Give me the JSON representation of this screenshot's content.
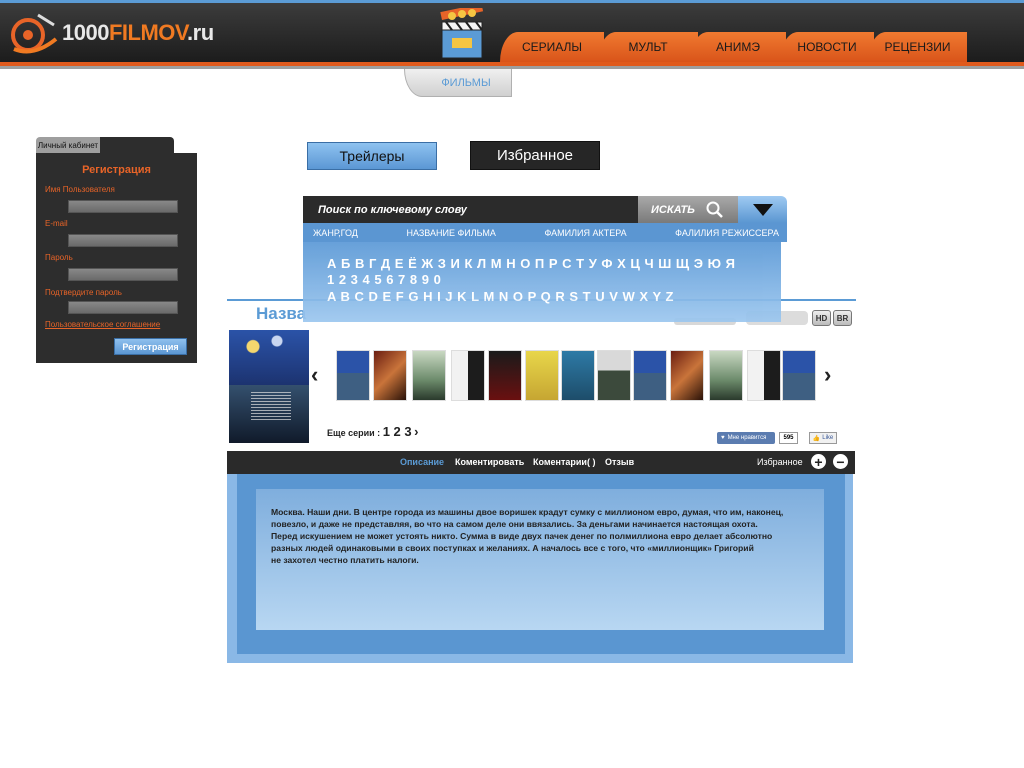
{
  "logo": {
    "text_a": "1000",
    "text_b": "FILMOV",
    "text_c": ".ru",
    "icon": "film-reel-logo-icon"
  },
  "nav": {
    "items": [
      "СЕРИАЛЫ",
      "МУЛЬТ",
      "АНИМЭ",
      "НОВОСТИ",
      "РЕЦЕНЗИИ"
    ],
    "sub_tab": "ФИЛЬМЫ",
    "clapper_icon": "clapperboard-icon"
  },
  "cabinet": {
    "tab_label": "Личный кабинет",
    "title": "Регистрация",
    "fields": [
      "Имя Пользователя",
      "E-mail",
      "Пароль",
      "Подтвердите пароль"
    ],
    "agreement": "Пользовательское соглашение",
    "submit": "Регистрация"
  },
  "buttons": {
    "trailers": "Трейлеры",
    "favorites": "Избранное"
  },
  "search": {
    "placeholder": "Поиск по ключевому слову",
    "button": "ИСКАТЬ",
    "search_icon": "magnifier-icon",
    "dropdown_icon": "triangle-down-icon"
  },
  "filters": [
    "ЖАНР,ГОД",
    "НАЗВАНИЕ ФИЛЬМА",
    "ФАМИЛИЯ АКТЕРА",
    "ФАЛИЛИЯ РЕЖИССЕРА"
  ],
  "alphabet": {
    "cyrillic": "А Б В Г Д Е Ё Ж З И К Л М Н О П Р С Т У Ф Х Ц Ч Ш Щ Э Ю Я",
    "digits": "1 2 3 4 5 6 7 8 9 0",
    "latin": "A B C D E F G H I J K L M N O P Q R S T U V W X Y Z"
  },
  "film": {
    "title_visible": "Назва",
    "quality": [
      "HD",
      "BR"
    ],
    "more_series_label": "Еще серии :",
    "more_series_pages": "1 2 3",
    "more_arrow": "›"
  },
  "social": {
    "like_label": "Мне нравится",
    "like_count": "595",
    "fb_label": "Like"
  },
  "info_bar": {
    "tabs": [
      "Описание",
      "Коментировать",
      "Коментарии( )",
      "Отзыв"
    ],
    "favorites": "Избранное"
  },
  "description": "Москва. Наши дни. В центре города из машины двое воришек крадут сумку с миллионом евро, думая, что им, наконец,\n повезло, и даже не представляя, во что на самом деле они ввязались. За деньгами начинается настоящая охота.\nПеред искушением не может устоять никто. Сумма в виде двух пачек денег по полмиллиона евро делает абсолютно\nразных людей одинаковыми в своих поступках и желаниях. А началось все с того, что «миллионщик» Григорий\nне захотел честно платить налоги.",
  "colors": {
    "accent_orange": "#e86428",
    "accent_blue": "#5b9bd5",
    "dark": "#2a2a2a"
  }
}
